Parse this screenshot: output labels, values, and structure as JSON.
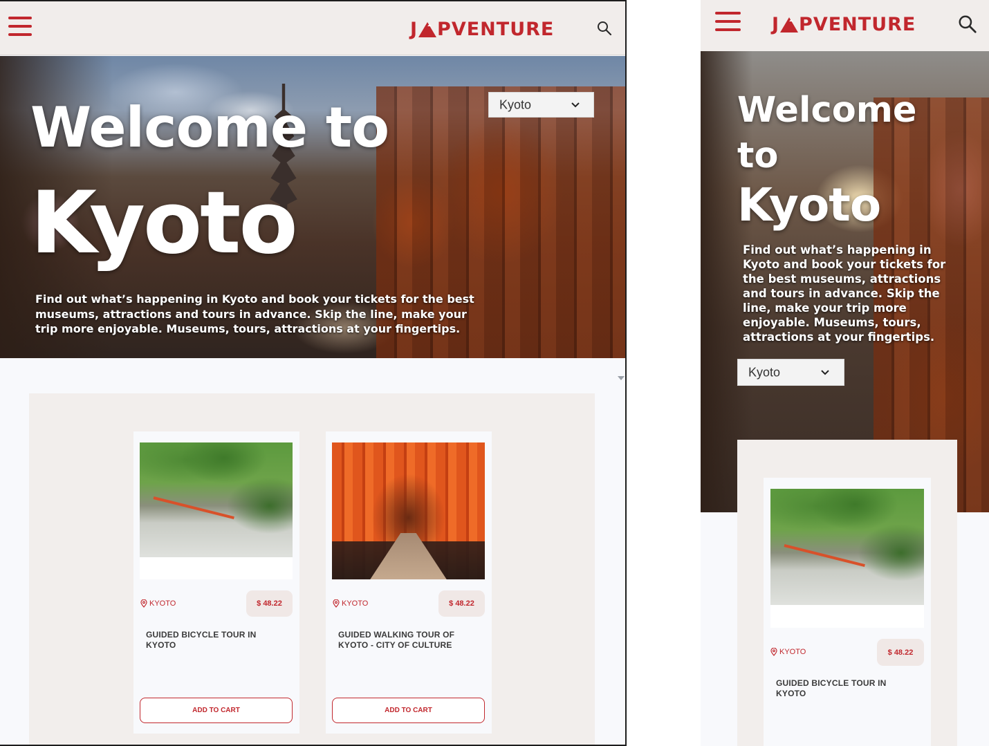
{
  "brand": {
    "logo": "JAPVENTURE",
    "logo_prefix": "J",
    "logo_suffix": "PVENTURE",
    "accent_color": "#c1272d"
  },
  "icons": {
    "menu": "hamburger-menu-icon",
    "search": "search-icon",
    "location": "location-pin-icon",
    "dropdown": "chevron-down-icon"
  },
  "desktop": {
    "hero": {
      "title_line1": "Welcome to",
      "title_line2": "Kyoto",
      "subtitle": "Find out what’s happening in Kyoto and book your tickets for the best museums, attractions and tours in advance. Skip the line, make your trip more enjoyable. Museums, tours, attractions at your fingertips.",
      "city_select": "Kyoto"
    },
    "cards": [
      {
        "location": "KYOTO",
        "price": "$ 48.22",
        "name": "GUIDED BICYCLE TOUR IN KYOTO",
        "button": "ADD TO CART",
        "image": "park-path-photo"
      },
      {
        "location": "KYOTO",
        "price": "$ 48.22",
        "name": "GUIDED WALKING TOUR OF KYOTO - CITY OF CULTURE",
        "button": "ADD TO CART",
        "image": "torii-gates-photo"
      }
    ]
  },
  "mobile": {
    "hero": {
      "title_line1": "Welcome",
      "title_line2": "to",
      "title_line3": "Kyoto",
      "subtitle": "Find out what’s happening in Kyoto and book your tickets for the best museums, attractions and tours in advance. Skip the line, make your trip more enjoyable. Museums, tours, attractions at your fingertips.",
      "city_select": "Kyoto"
    },
    "cards": [
      {
        "location": "KYOTO",
        "price": "$ 48.22",
        "name": "GUIDED BICYCLE TOUR IN KYOTO",
        "image": "park-path-photo"
      }
    ]
  }
}
